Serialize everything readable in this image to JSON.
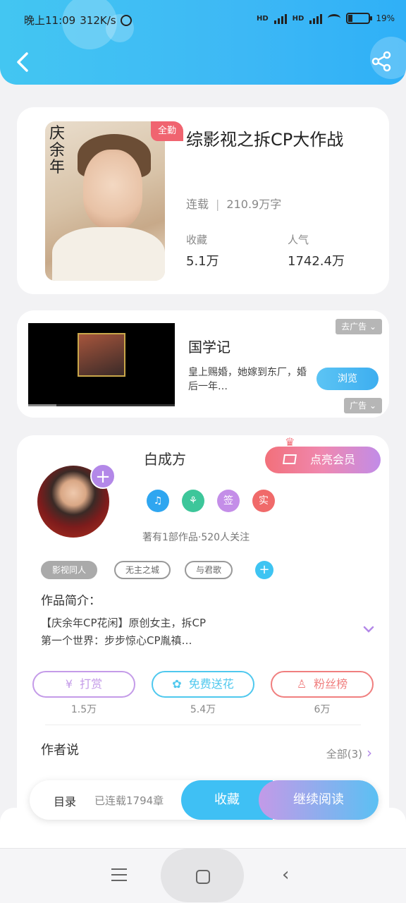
{
  "status_bar": {
    "time": "晚上11:09",
    "speed": "312K/s",
    "network1": "HD",
    "network2": "HD",
    "battery": "19%",
    "battery_level": 0.19
  },
  "book": {
    "title": "综影视之拆CP大作战",
    "status": "连载",
    "word_count": "210.9万字",
    "badge": "全勤",
    "cover_text": "庆余年",
    "favorites_label": "收藏",
    "favorites_value": "5.1万",
    "popularity_label": "人气",
    "popularity_value": "1742.4万"
  },
  "ad": {
    "title": "国学记",
    "description": "皇上赐婚，她嫁到东厂，婚后一年…",
    "button": "浏览",
    "tag_top": "去广告",
    "tag_bottom": "广告"
  },
  "author": {
    "name": "白成方",
    "vip_button": "点亮会员",
    "badges": [
      {
        "label": "♫",
        "color": "#2fa6f0"
      },
      {
        "label": "⚘",
        "color": "#3dc69a"
      },
      {
        "label": "签",
        "color": "#c48ee8"
      },
      {
        "label": "实",
        "color": "#f06a6a"
      }
    ],
    "stats": "著有1部作品·520人关注",
    "tags": [
      "影视同人",
      "无主之城",
      "与君歌"
    ],
    "intro_title": "作品简介：",
    "intro_line1": "【庆余年CP花闲】原创女主，拆CP",
    "intro_line2": "第一个世界：步步惊心CP胤禛…"
  },
  "actions": [
    {
      "label": "打赏",
      "icon": "¥",
      "count": "1.5万",
      "color": "#c49be8"
    },
    {
      "label": "免费送花",
      "icon": "✿",
      "count": "5.4万",
      "color": "#4fc8ee"
    },
    {
      "label": "粉丝榜",
      "icon": "♙",
      "count": "6万",
      "color": "#f07f7f"
    }
  ],
  "author_says": {
    "title": "作者说",
    "all_label": "全部(3)"
  },
  "bottom_bar": {
    "directory": "目录",
    "status": "已连载1794章",
    "favorite": "收藏",
    "continue": "继续阅读"
  }
}
